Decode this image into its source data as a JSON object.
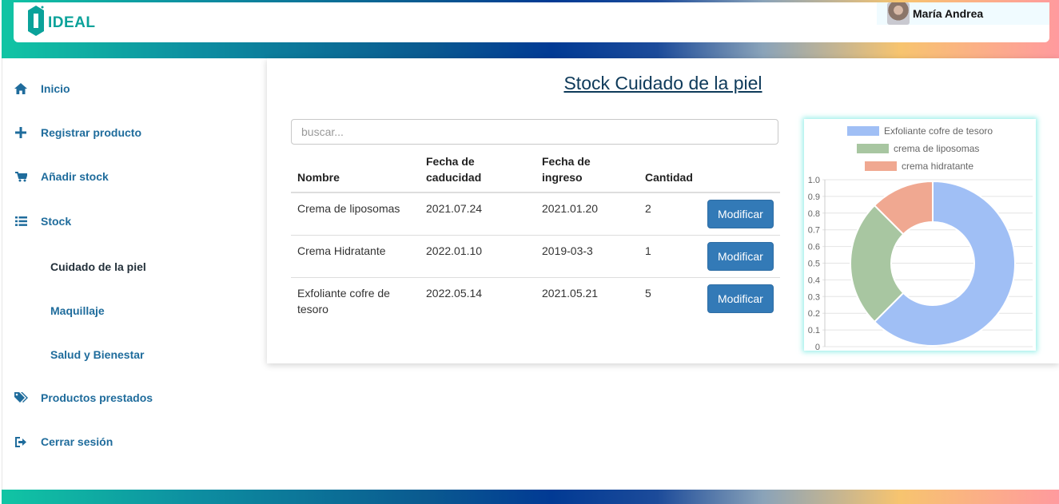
{
  "brand": {
    "logo_text": "IDEAL",
    "color": "#0aa29a"
  },
  "user": {
    "name": "María Andrea"
  },
  "sidebar": {
    "items": [
      {
        "label": "Inicio",
        "icon": "home-icon"
      },
      {
        "label": "Registrar producto",
        "icon": "plus-icon"
      },
      {
        "label": "Añadir stock",
        "icon": "cart-icon"
      },
      {
        "label": "Stock",
        "icon": "list-icon"
      },
      {
        "label": "Productos prestados",
        "icon": "tags-icon"
      },
      {
        "label": "Cerrar sesión",
        "icon": "logout-icon"
      }
    ],
    "subitems": [
      {
        "label": "Cuidado de la piel",
        "active": true
      },
      {
        "label": "Maquillaje",
        "active": false
      },
      {
        "label": "Salud y Bienestar",
        "active": false
      }
    ]
  },
  "main": {
    "title": "Stock Cuidado de la piel",
    "search_placeholder": "buscar...",
    "table": {
      "headers": [
        "Nombre",
        "Fecha de caducidad",
        "Fecha de ingreso",
        "Cantidad",
        ""
      ],
      "rows": [
        {
          "nombre": "Crema de liposomas",
          "caducidad": "2021.07.24",
          "ingreso": "2021.01.20",
          "cantidad": "2",
          "action": "Modificar"
        },
        {
          "nombre": "Crema Hidratante",
          "caducidad": "2022.01.10",
          "ingreso": "2019-03-3",
          "cantidad": "1",
          "action": "Modificar"
        },
        {
          "nombre": "Exfoliante cofre de tesoro",
          "caducidad": "2022.05.14",
          "ingreso": "2021.05.21",
          "cantidad": "5",
          "action": "Modificar"
        }
      ]
    }
  },
  "chart_data": {
    "type": "doughnut",
    "series": [
      {
        "name": "Exfoliante cofre de tesoro",
        "value": 5,
        "color": "#a0bff5"
      },
      {
        "name": "crema de liposomas",
        "value": 2,
        "color": "#a8c6a1"
      },
      {
        "name": "crema hidratante",
        "value": 1,
        "color": "#f0a891"
      }
    ],
    "y_ticks": [
      "1.0",
      "0.9",
      "0.8",
      "0.7",
      "0.6",
      "0.5",
      "0.4",
      "0.3",
      "0.2",
      "0.1",
      "0"
    ],
    "ylim": [
      0,
      1
    ],
    "grid": true,
    "legend_position": "top"
  },
  "colors": {
    "primary_button": "#337ab7",
    "nav_text": "#1f6c9c"
  }
}
